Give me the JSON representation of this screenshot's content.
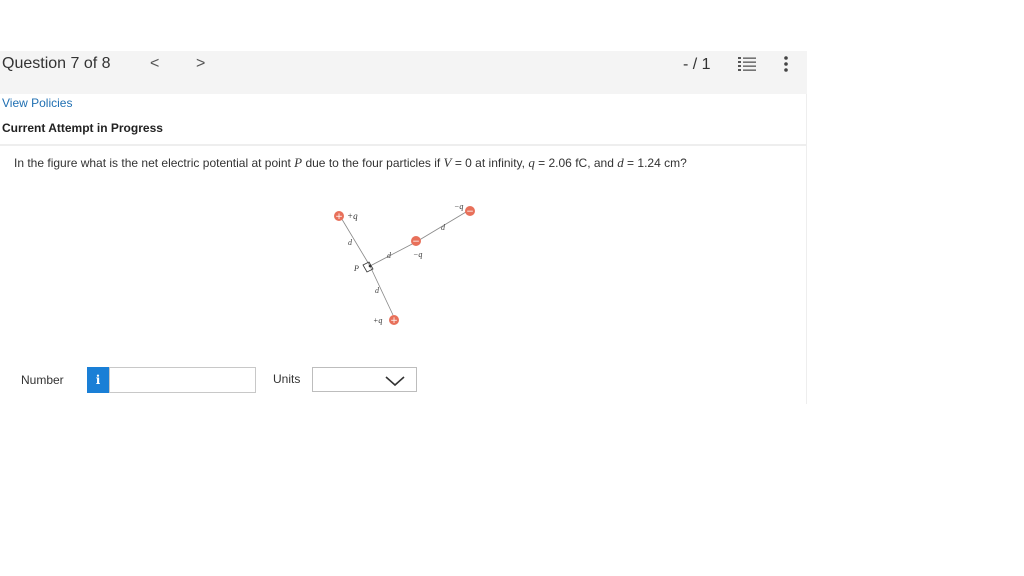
{
  "header": {
    "question_label": "Question 7 of 8",
    "prev_symbol": "<",
    "next_symbol": ">",
    "score": "- / 1",
    "list_icon": "list-icon",
    "more_icon": "more-vertical-icon"
  },
  "info": {
    "policies_link": "View Policies",
    "attempt_status": "Current Attempt in Progress"
  },
  "question": {
    "t1": "In the figure what is the net electric potential at point ",
    "v_p": "P",
    "t2": " due to the four particles if ",
    "v_V": "V",
    "t3": " = 0 at infinity, ",
    "v_q": "q",
    "t4": " = 2.06 fC, and ",
    "v_d": "d",
    "t5": " = 1.24 cm?"
  },
  "figure": {
    "label_plus_q_top": "+q",
    "label_minus_q_right": "−q",
    "label_minus_q_mid": "−q",
    "label_plus_q_bottom": "+q",
    "label_d_upper": "d",
    "label_d_mid": "d",
    "label_d_lower": "d",
    "label_d_right": "d",
    "label_P": "P",
    "plus_sign": "+",
    "minus_sign": "−",
    "charge_color": "#e8705a"
  },
  "answer": {
    "number_label": "Number",
    "info_button": "i",
    "number_value": "",
    "units_label": "Units",
    "units_value": ""
  }
}
